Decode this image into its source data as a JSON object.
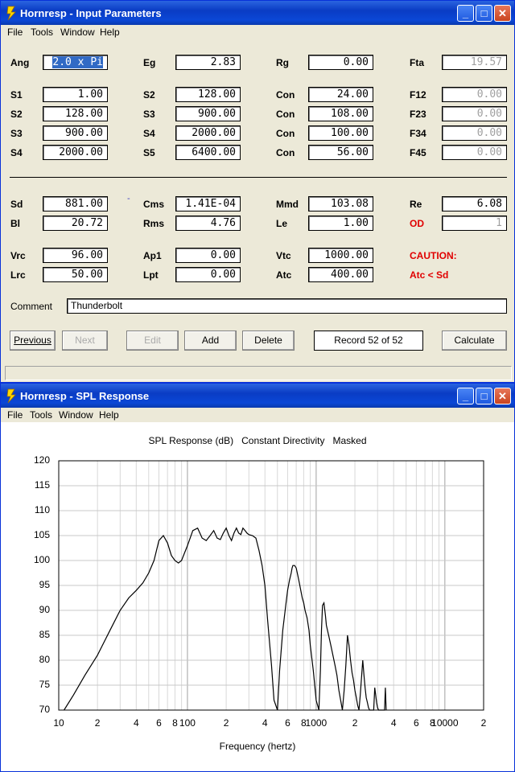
{
  "win1": {
    "title": "Hornresp - Input Parameters",
    "menu": [
      "File",
      "Tools",
      "Window",
      "Help"
    ],
    "rows": [
      {
        "y": 0,
        "cells": [
          {
            "l": "Ang",
            "v": "2.0 x Pi",
            "sel": true
          },
          {
            "l": "Eg",
            "v": "2.83"
          },
          {
            "l": "Rg",
            "v": "0.00"
          },
          {
            "l": "Fta",
            "v": "19.57",
            "gray": true
          }
        ]
      },
      {
        "y": 1,
        "cells": [
          {
            "l": "S1",
            "v": "1.00"
          },
          {
            "l": "S2",
            "v": "128.00"
          },
          {
            "l": "Con",
            "v": "24.00"
          },
          {
            "l": "F12",
            "v": "0.00",
            "gray": true
          }
        ]
      },
      {
        "y": 2,
        "cells": [
          {
            "l": "S2",
            "v": "128.00"
          },
          {
            "l": "S3",
            "v": "900.00"
          },
          {
            "l": "Con",
            "v": "108.00"
          },
          {
            "l": "F23",
            "v": "0.00",
            "gray": true
          }
        ]
      },
      {
        "y": 3,
        "cells": [
          {
            "l": "S3",
            "v": "900.00"
          },
          {
            "l": "S4",
            "v": "2000.00"
          },
          {
            "l": "Con",
            "v": "100.00"
          },
          {
            "l": "F34",
            "v": "0.00",
            "gray": true
          }
        ]
      },
      {
        "y": 4,
        "cells": [
          {
            "l": "S4",
            "v": "2000.00"
          },
          {
            "l": "S5",
            "v": "6400.00"
          },
          {
            "l": "Con",
            "v": "56.00"
          },
          {
            "l": "F45",
            "v": "0.00",
            "gray": true
          }
        ]
      }
    ],
    "rows2": [
      {
        "cells": [
          {
            "l": "Sd",
            "v": "881.00"
          },
          {
            "l": "Cms",
            "v": "1.41E-04"
          },
          {
            "l": "Mmd",
            "v": "103.08"
          },
          {
            "l": "Re",
            "v": "6.08"
          }
        ]
      },
      {
        "cells": [
          {
            "l": "Bl",
            "v": "20.72"
          },
          {
            "l": "Rms",
            "v": "4.76"
          },
          {
            "l": "Le",
            "v": "1.00"
          },
          {
            "l": "OD",
            "v": "1",
            "gray": true,
            "red": true
          }
        ]
      },
      {
        "cells": [
          {
            "l": "Vrc",
            "v": "96.00"
          },
          {
            "l": "Ap1",
            "v": "0.00"
          },
          {
            "l": "Vtc",
            "v": "1000.00"
          },
          {
            "l": "CAUTION:",
            "red": true,
            "nofield": true
          }
        ]
      },
      {
        "cells": [
          {
            "l": "Lrc",
            "v": "50.00"
          },
          {
            "l": "Lpt",
            "v": "0.00"
          },
          {
            "l": "Atc",
            "v": "400.00"
          },
          {
            "l": "Atc < Sd",
            "red": true,
            "nofield": true
          }
        ]
      }
    ],
    "comment_label": "Comment",
    "comment_value": "Thunderbolt",
    "buttons": {
      "previous": "Previous",
      "next": "Next",
      "edit": "Edit",
      "add": "Add",
      "delete": "Delete",
      "record": "Record 52 of 52",
      "calculate": "Calculate"
    }
  },
  "win2": {
    "title": "Hornresp - SPL Response",
    "menu": [
      "File",
      "Tools",
      "Window",
      "Help"
    ]
  },
  "chart_data": {
    "type": "line",
    "title": "SPL Response (dB)   Constant Directivity   Masked",
    "xlabel": "Frequency (hertz)",
    "ylabel": "",
    "xscale": "log",
    "xlim": [
      10,
      20000
    ],
    "ylim": [
      70,
      120
    ],
    "yticks": [
      70,
      75,
      80,
      85,
      90,
      95,
      100,
      105,
      110,
      115,
      120
    ],
    "xtick_labels": [
      "10",
      "2",
      "4",
      "6",
      "8",
      "100",
      "2",
      "4",
      "6",
      "8",
      "1000",
      "2",
      "4",
      "6",
      "8",
      "10000",
      "2"
    ],
    "xtick_values": [
      10,
      20,
      40,
      60,
      80,
      100,
      200,
      400,
      600,
      800,
      1000,
      2000,
      4000,
      6000,
      8000,
      10000,
      20000
    ],
    "grid": true,
    "series": [
      {
        "x": [
          11,
          13,
          16,
          20,
          25,
          30,
          35,
          40,
          45,
          50,
          55,
          60,
          65,
          70,
          75,
          80,
          85,
          90,
          100,
          110,
          120,
          130,
          140,
          150,
          160,
          170,
          180,
          190,
          200,
          210,
          220,
          230,
          240,
          250,
          260,
          270,
          280,
          290,
          300,
          320,
          340,
          360,
          380,
          400,
          420,
          450,
          470,
          500,
          520,
          550,
          580,
          600,
          620,
          640,
          650,
          660,
          680,
          700,
          720,
          740,
          760,
          780,
          800,
          820,
          850,
          880,
          900,
          950,
          1000,
          1050,
          1080,
          1100,
          1120,
          1150,
          1180,
          1200,
          1250,
          1300,
          1350,
          1400,
          1450,
          1500,
          1550,
          1600,
          1650,
          1700,
          1750,
          1800,
          1850,
          1900,
          1950,
          2000,
          2050,
          2100,
          2150,
          2200,
          2300,
          2350,
          2400,
          2450,
          2500,
          2550,
          2600,
          2650,
          2700,
          2800,
          2850,
          2900,
          2950,
          3000,
          3050,
          3100,
          3200,
          3300,
          3400,
          3450,
          3500
        ],
        "y": [
          70,
          73,
          77,
          81,
          86,
          90,
          92.5,
          94,
          95.5,
          97.5,
          100,
          104,
          105,
          103.5,
          101,
          100,
          99.5,
          100,
          103,
          106,
          106.5,
          104.5,
          104,
          105,
          106,
          104.5,
          104.2,
          105.5,
          106.5,
          105,
          104,
          105.5,
          106.5,
          105.5,
          105.2,
          106.5,
          106,
          105.5,
          105.2,
          105,
          104.5,
          102,
          99,
          95,
          88,
          79,
          72,
          70,
          78,
          86,
          91,
          94,
          96,
          97.5,
          98.5,
          99,
          99,
          98.5,
          97,
          95.5,
          94,
          92.5,
          91.5,
          90,
          88.5,
          86,
          83,
          78,
          72,
          70,
          78,
          86,
          91,
          91.5,
          89,
          87,
          85,
          83,
          81,
          79,
          77,
          74,
          72,
          70,
          74,
          79,
          85,
          83,
          80,
          77.5,
          76,
          74,
          72.5,
          71,
          70,
          73,
          80,
          77,
          74.5,
          72.5,
          71.5,
          70.5,
          70,
          70,
          70,
          70,
          74.5,
          73,
          71.5,
          70.5,
          70,
          70,
          70,
          70,
          70,
          74.5,
          70
        ]
      }
    ]
  }
}
